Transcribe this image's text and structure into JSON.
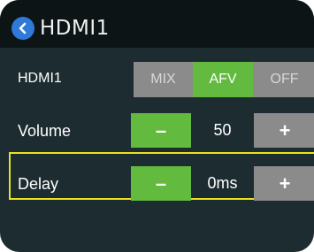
{
  "header": {
    "title": "HDMI1",
    "back_icon": "chevron-left-icon",
    "accent": "#2f79d8"
  },
  "mode_row": {
    "label": "HDMI1",
    "options": [
      {
        "label": "MIX",
        "selected": false
      },
      {
        "label": "AFV",
        "selected": true
      },
      {
        "label": "OFF",
        "selected": false
      }
    ],
    "selected_color": "#62bb3e"
  },
  "volume_row": {
    "label": "Volume",
    "decrement": "–",
    "value": "50",
    "increment": "+"
  },
  "delay_row": {
    "label": "Delay",
    "decrement": "–",
    "value": "0ms",
    "increment": "+",
    "highlight_color": "#e6e21f"
  }
}
